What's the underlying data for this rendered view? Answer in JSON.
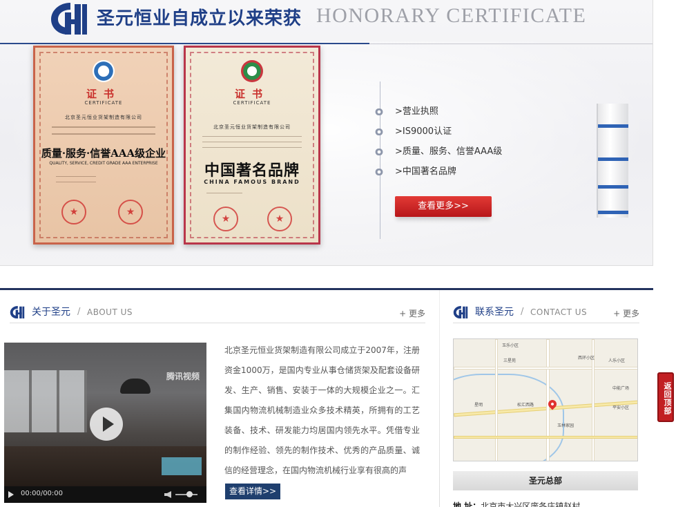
{
  "honor": {
    "title": "圣元恒业自成立以来荣获",
    "subtitle": "HONORARY CERTIFICATE",
    "items": [
      ">营业执照",
      ">IS9000认证",
      ">质量、服务、信誉AAA级",
      ">中国著名品牌"
    ],
    "more_label": "查看更多>>",
    "certificates": [
      {
        "heading": "证书",
        "heading_en": "CERTIFICATE",
        "company": "北京圣元恒业货架制造有限公司",
        "award": "质量·服务·信誉AAA级企业",
        "award_en": "QUALITY, SERVICE, CREDIT GRADE AAA ENTERPRISE"
      },
      {
        "heading": "证书",
        "heading_en": "CERTIFICATE",
        "company": "北京圣元恒业货架制造有限公司",
        "award": "中国著名品牌",
        "award_en": "CHINA FAMOUS BRAND"
      }
    ]
  },
  "about": {
    "title": "关于圣元",
    "separator": "/",
    "title_en": "ABOUT US",
    "more": "+ 更多",
    "text": "北京圣元恒业货架制造有限公司成立于2007年，注册资金1000万，是国内专业从事仓储货架及配套设备研发、生产、销售、安装于一体的大规模企业之一。汇集国内物流机械制造业众多技术精英，所拥有的工艺装备、技术、研发能力均居国内领先水平。凭借专业的制作经验、领先的制作技术、优秀的产品质量、诚信的经营理念，在国内物流机械行业享有很高的声",
    "detail_label": "查看详情>>",
    "video": {
      "brand": "腾讯视频",
      "time": "00:00/00:00"
    }
  },
  "contact": {
    "title": "联系圣元",
    "separator": "/",
    "title_en": "CONTACT US",
    "more": "+ 更多",
    "hq_label": "圣元总部",
    "address_label": "地 址：",
    "address_value": "北京市大兴区庞各庄镇赵村",
    "map_labels": [
      "玉乐小区",
      "三星苑",
      "人乐小区",
      "西环小区",
      "中能广场",
      "星明",
      "松汇西路",
      "玉林家园",
      "平安小区"
    ]
  },
  "back_top_label": "返回顶部",
  "colors": {
    "brand_blue": "#1f3f87",
    "accent_red": "#c21f23",
    "dark_navy": "#23335e"
  }
}
